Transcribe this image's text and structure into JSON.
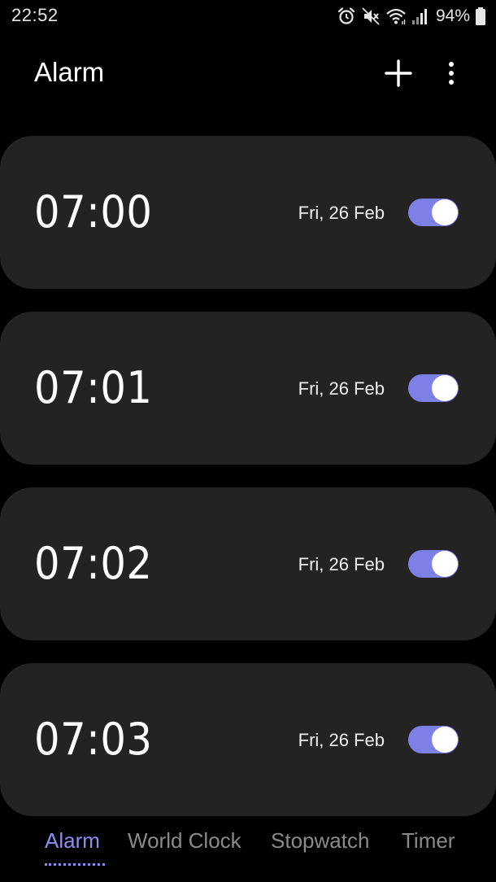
{
  "status_bar": {
    "time": "22:52",
    "battery": "94%",
    "icons": [
      "alarm-icon",
      "mute-icon",
      "wifi-icon",
      "signal-icon",
      "battery-icon"
    ]
  },
  "header": {
    "title": "Alarm",
    "add_icon": "plus-icon",
    "more_icon": "more-vertical-icon"
  },
  "alarms": [
    {
      "time": "07:00",
      "date": "Fri, 26 Feb",
      "enabled": true
    },
    {
      "time": "07:01",
      "date": "Fri, 26 Feb",
      "enabled": true
    },
    {
      "time": "07:02",
      "date": "Fri, 26 Feb",
      "enabled": true
    },
    {
      "time": "07:03",
      "date": "Fri, 26 Feb",
      "enabled": true
    }
  ],
  "tabs": [
    {
      "label": "Alarm",
      "active": true
    },
    {
      "label": "World Clock",
      "active": false
    },
    {
      "label": "Stopwatch",
      "active": false
    },
    {
      "label": "Timer",
      "active": false
    }
  ],
  "colors": {
    "accent": "#7e80e8",
    "card": "#232323",
    "background": "#000000",
    "tab_inactive": "#8a8a8a"
  }
}
